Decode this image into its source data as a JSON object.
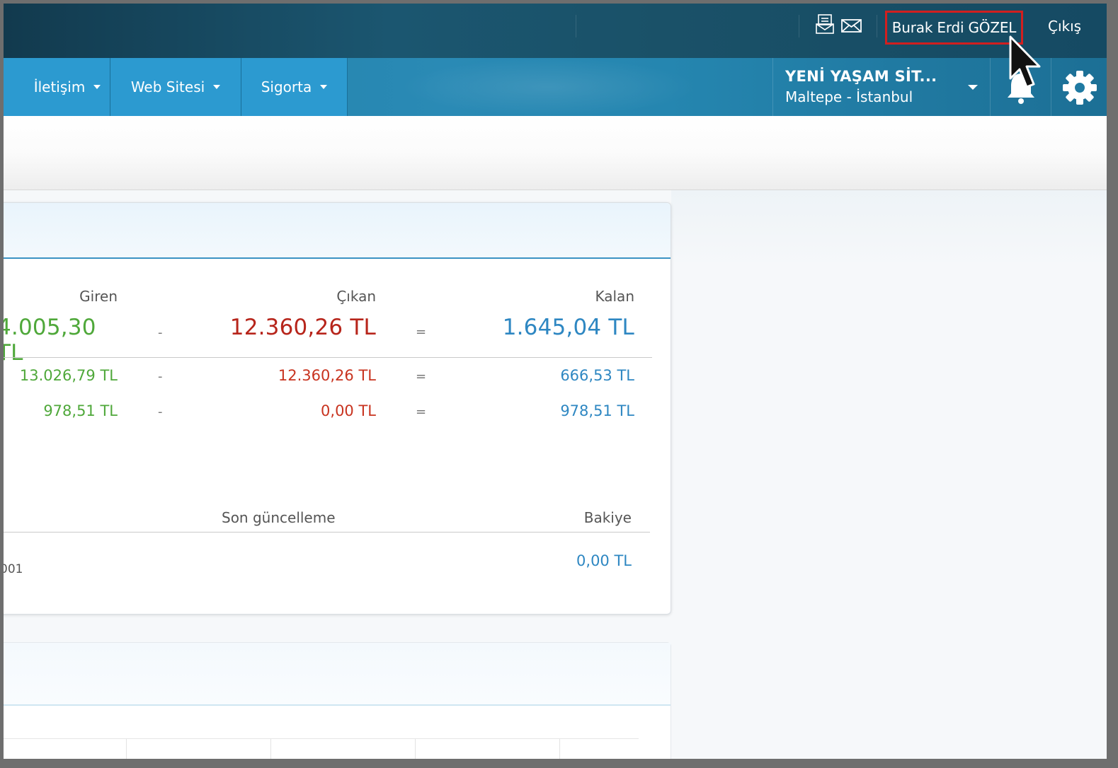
{
  "topbar": {
    "user_name": "Burak Erdi GÖZEL",
    "logout_label": "Çıkış",
    "icons": [
      "message-board-icon",
      "mail-icon"
    ]
  },
  "nav": {
    "items": [
      {
        "label": "İletişim"
      },
      {
        "label": "Web Sitesi"
      },
      {
        "label": "Sigorta"
      }
    ],
    "site": {
      "name": "YENİ YAŞAM SİT...",
      "location": "Maltepe - İstanbul"
    },
    "icons": [
      "bell-icon",
      "gear-icon"
    ]
  },
  "summary": {
    "headers": {
      "in": "Giren",
      "out": "Çıkan",
      "balance": "Kalan"
    },
    "total": {
      "in": "4.005,30 TL",
      "minus": "-",
      "out": "12.360,26 TL",
      "equals": "=",
      "balance": "1.645,04 TL"
    },
    "rows": [
      {
        "in": "13.026,79 TL",
        "minus": "-",
        "out": "12.360,26 TL",
        "equals": "=",
        "balance": "666,53 TL"
      },
      {
        "in": "978,51 TL",
        "minus": "-",
        "out": "0,00 TL",
        "equals": "=",
        "balance": "978,51 TL"
      }
    ]
  },
  "accounts": {
    "headers": {
      "last_update": "Son güncelleme",
      "balance": "Bakiye"
    },
    "rows": [
      {
        "code": "001",
        "balance": "0,00 TL"
      }
    ]
  },
  "colors": {
    "in": "#4fa83a",
    "out": "#b7251b",
    "balance": "#2e87c2",
    "highlight": "#d21f1f",
    "nav": "#2c9ad0"
  }
}
